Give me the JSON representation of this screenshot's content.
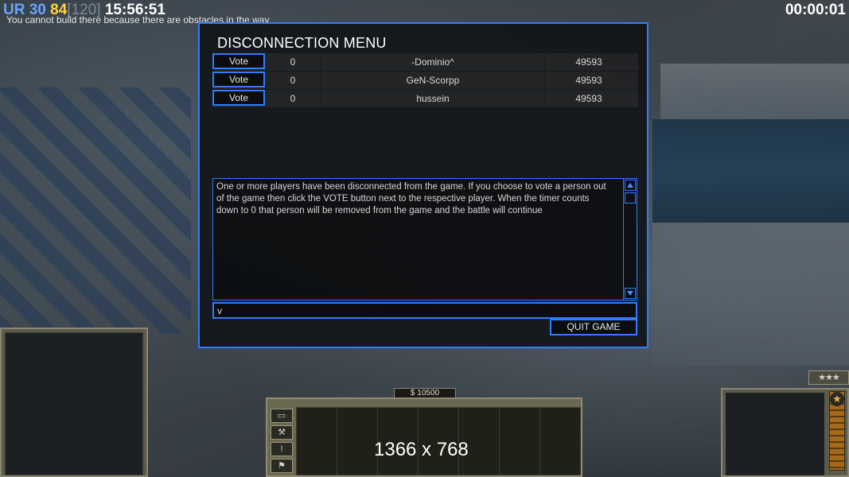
{
  "hud": {
    "ur_label": "UR",
    "ur_value": "30",
    "fps": "84",
    "fps_bracket": "[120]",
    "clock": "15:56:51",
    "message": "You cannot build there because there are obstacles in the way",
    "timer": "00:00:01"
  },
  "dialog": {
    "title": "DISCONNECTION MENU",
    "players": [
      {
        "vote_label": "Vote",
        "count": "0",
        "name": "-Dominio^",
        "ping": "49593"
      },
      {
        "vote_label": "Vote",
        "count": "0",
        "name": "GeN-Scorpp",
        "ping": "49593"
      },
      {
        "vote_label": "Vote",
        "count": "0",
        "name": "hussein",
        "ping": "49593"
      }
    ],
    "message": "One or more players have been disconnected from the game. If you choose to vote a person out of the game then click the VOTE button next to the respective player. When the timer counts down to 0 that person will be removed from the game and the battle will continue",
    "chat_value": "v",
    "quit_label": "QUIT GAME"
  },
  "bottom_hud": {
    "money": "$ 10500",
    "resolution": "1366 x 768",
    "rank": "★★★",
    "tab_icons": [
      "structures-icon",
      "wrench-icon",
      "alert-icon",
      "flag-icon"
    ],
    "tab_glyphs": [
      "▭",
      "⚒",
      "!",
      "⚑"
    ]
  },
  "colors": {
    "accent": "#2f7dff",
    "ur": "#6aa3ff",
    "fps": "#ffd23a"
  }
}
